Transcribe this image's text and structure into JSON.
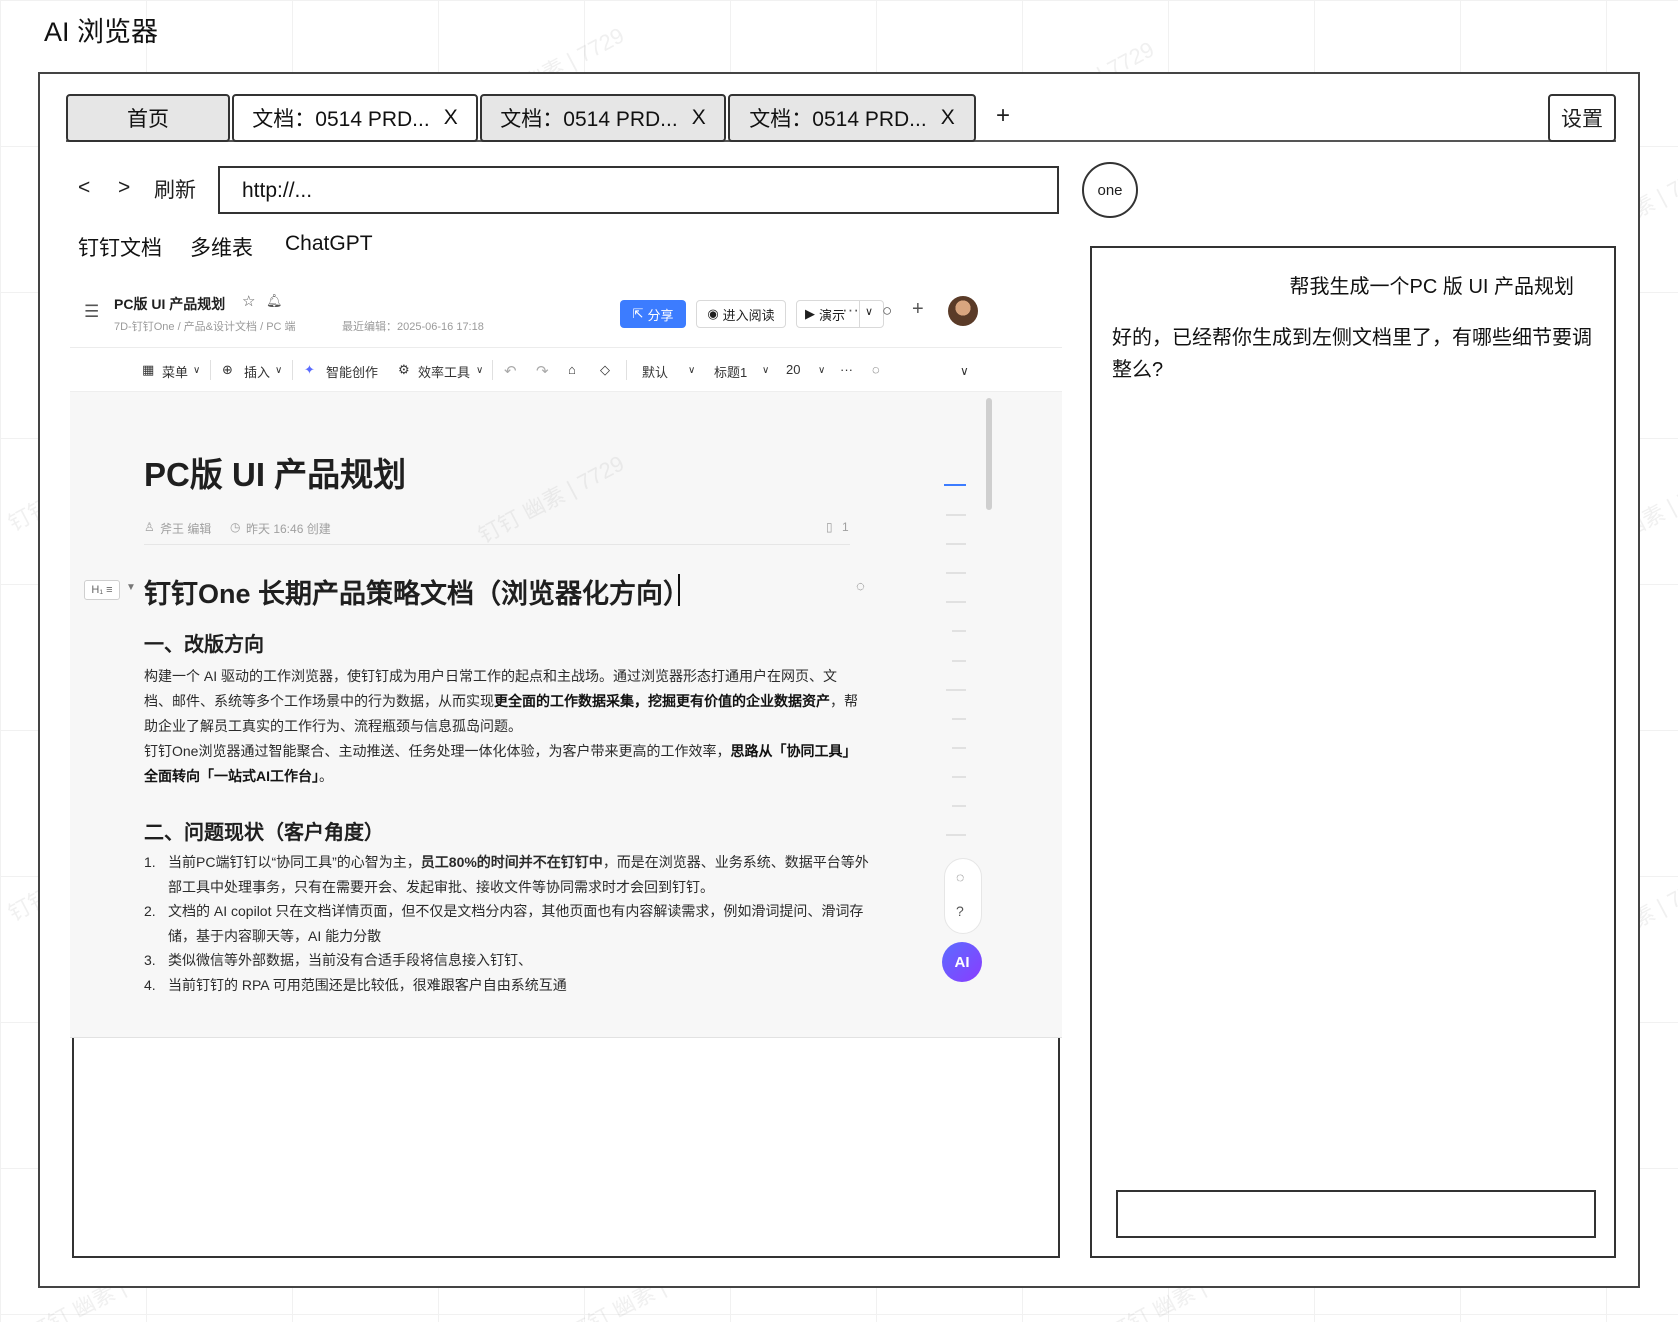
{
  "page_title": "AI 浏览器",
  "tabs": [
    {
      "label": "首页",
      "close": ""
    },
    {
      "label": "文档：0514 PRD...",
      "close": "X"
    },
    {
      "label": "文档：0514 PRD...",
      "close": "X"
    },
    {
      "label": "文档：0514 PRD...",
      "close": "X"
    }
  ],
  "new_tab": "+",
  "settings": "设置",
  "nav": {
    "back": "<",
    "forward": ">",
    "refresh": "刷新",
    "url": "http://..."
  },
  "account": "one",
  "bookmarks": [
    "钉钉文档",
    "多维表",
    "ChatGPT"
  ],
  "doc": {
    "header": {
      "name": "PC版 UI 产品规划",
      "path": "7D-钉钉One / 产品&设计文档 / PC 端",
      "edited": "最近编辑：2025-06-16 17:18",
      "share": "分享",
      "read": "进入阅读",
      "present": "演示"
    },
    "toolbar": {
      "menu": "菜单",
      "insert": "插入",
      "smart": "智能创作",
      "tools": "效率工具",
      "style": "默认",
      "heading": "标题1",
      "size": "20"
    },
    "title": "PC版 UI 产品规划",
    "meta": {
      "author": "斧王 编辑",
      "created": "昨天 16:46 创建",
      "count": "1"
    },
    "heading_tag": "H₁ ≡",
    "h1": "钉钉One 长期产品策略文档（浏览器化方向）",
    "section1": "一、改版方向",
    "para1_a": "构建一个 AI 驱动的工作浏览器，使钉钉成为用户日常工作的起点和主战场。通过浏览器形态打通用户在网页、文档、邮件、系统等多个工作场景中的行为数据，从而实现",
    "para1_b": "更全面的工作数据采集，挖掘更有价值的企业数据资产",
    "para1_c": "，帮助企业了解员工真实的工作行为、流程瓶颈与信息孤岛问题。",
    "para2_a": "钉钉One浏览器通过智能聚合、主动推送、任务处理一体化体验，为客户带来更高的工作效率，",
    "para2_b": "思路从「协同工具」全面转向「一站式AI工作台」",
    "para2_c": "。",
    "section2": "二、问题现状（客户角度）",
    "list": [
      {
        "num": "1.",
        "a": "当前PC端钉钉以“协同工具”的心智为主，",
        "b": "员工80%的时间并不在钉钉中",
        "c": "，而是在浏览器、业务系统、数据平台等外部工具中处理事务，只有在需要开会、发起审批、接收文件等协同需求时才会回到钉钉。"
      },
      {
        "num": "2.",
        "a": "文档的 AI copilot 只在文档详情页面，但不仅是文档分内容，其他页面也有内容解读需求，例如滑词提问、滑词存储，基于内容聊天等，AI 能力分散",
        "b": "",
        "c": ""
      },
      {
        "num": "3.",
        "a": "类似微信等外部数据，当前没有合适手段将信息接入钉钉、",
        "b": "",
        "c": ""
      },
      {
        "num": "4.",
        "a": "当前钉钉的 RPA 可用范围还是比较低，很难跟客户自由系统互通",
        "b": "",
        "c": ""
      }
    ],
    "ai_button": "AI"
  },
  "chat": {
    "user_message": "帮我生成一个PC 版 UI 产品规划",
    "assistant_message": "好的，已经帮你生成到左侧文档里了，有哪些细节要调整么?",
    "input_value": ""
  },
  "watermark": "钉钉 幽素 | 7729",
  "colors": {
    "accent": "#3c7cff",
    "ai_gradient_start": "#5b6cff",
    "ai_gradient_end": "#8a3cff"
  }
}
